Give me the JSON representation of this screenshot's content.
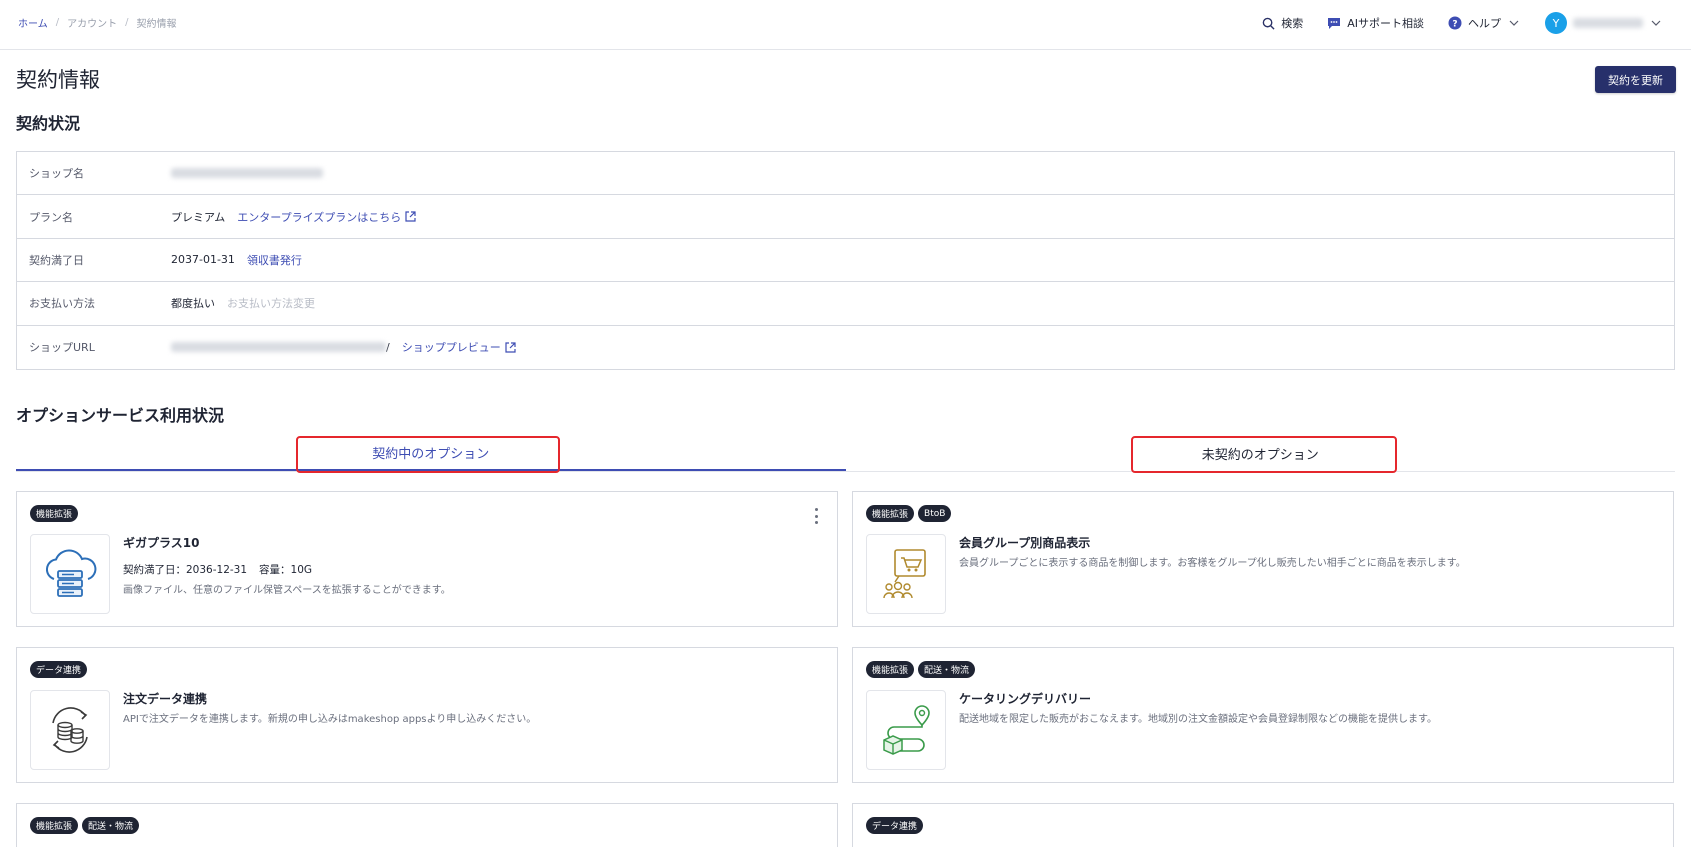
{
  "breadcrumb": {
    "home": "ホーム",
    "account": "アカウント",
    "current": "契約情報",
    "sep": "/"
  },
  "header": {
    "search": "検索",
    "ai_support": "AIサポート相談",
    "help": "ヘルプ",
    "user_initial": "Y"
  },
  "page": {
    "title": "契約情報",
    "update_button": "契約を更新"
  },
  "contract": {
    "section_title": "契約状況",
    "rows": [
      {
        "label": "ショップ名"
      },
      {
        "label": "プラン名",
        "value": "プレミアム",
        "link": "エンタープライズプランはこちら"
      },
      {
        "label": "契約満了日",
        "value": "2037-01-31",
        "link": "領収書発行"
      },
      {
        "label": "お支払い方法",
        "value": "都度払い",
        "link": "お支払い方法変更"
      },
      {
        "label": "ショップURL",
        "url_tail": "/",
        "link": "ショッププレビュー"
      }
    ]
  },
  "options": {
    "section_title": "オプションサービス利用状況",
    "tabs": [
      {
        "label": "契約中のオプション"
      },
      {
        "label": "未契約のオプション"
      }
    ],
    "cards": [
      {
        "tags": [
          "機能拡張"
        ],
        "title": "ギガプラス10",
        "meta_expiry": "契約満了日：2036-12-31",
        "meta_capacity": "容量：10G",
        "desc": "画像ファイル、任意のファイル保管スペースを拡張することができます。",
        "icon": "cloud-server-icon"
      },
      {
        "tags": [
          "機能拡張",
          "BtoB"
        ],
        "title": "会員グループ別商品表示",
        "desc": "会員グループごとに表示する商品を制御します。お客様をグループ化し販売したい相手ごとに商品を表示します。",
        "icon": "member-group-cart-icon"
      },
      {
        "tags": [
          "データ連携"
        ],
        "title": "注文データ連携",
        "desc": "APIで注文データを連携します。新規の申し込みはmakeshop appsより申し込みください。",
        "icon": "data-sync-icon"
      },
      {
        "tags": [
          "機能拡張",
          "配送・物流"
        ],
        "title": "ケータリングデリバリー",
        "desc": "配送地域を限定した販売がおこなえます。地域別の注文金額設定や会員登録制限などの機能を提供します。",
        "icon": "delivery-route-icon"
      },
      {
        "tags": [
          "機能拡張",
          "配送・物流"
        ]
      },
      {
        "tags": [
          "データ連携"
        ]
      }
    ]
  },
  "colors": {
    "accent": "#3e4db3",
    "primary_button": "#27306b",
    "highlight": "#e5272d",
    "avatar": "#1aa0e8"
  }
}
